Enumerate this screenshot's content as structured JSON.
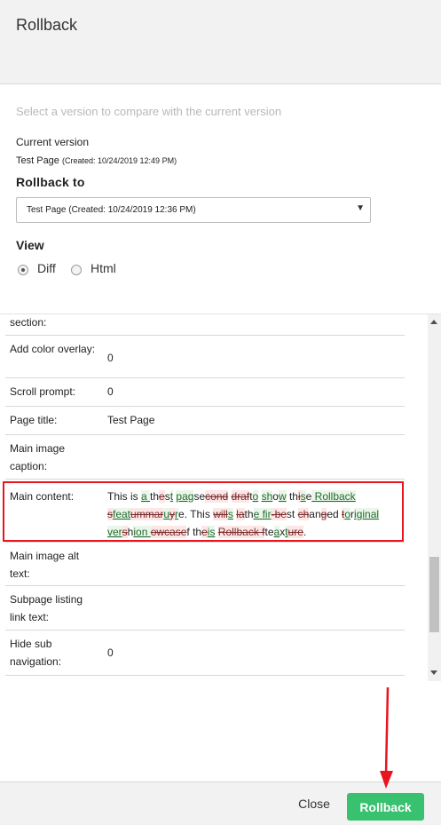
{
  "dialog": {
    "title": "Rollback"
  },
  "controls": {
    "hint": "Select a version to compare with the current version",
    "current_label": "Current version",
    "current_name": "Test Page",
    "current_created": "(Created: 10/24/2019 12:49 PM)",
    "rollback_label": "Rollback to",
    "selected_version": "Test Page (Created: 10/24/2019 12:36 PM)",
    "view_label": "View",
    "view_options": [
      "Diff",
      "Html"
    ],
    "view_selected": "Diff"
  },
  "rows": [
    {
      "label": "section:",
      "value": ""
    },
    {
      "label": "Add color overlay:",
      "value": "0"
    },
    {
      "label": "Scroll prompt:",
      "value": "0"
    },
    {
      "label": "Page title:",
      "value": "Test Page"
    },
    {
      "label": "Main image caption:",
      "value": ""
    },
    {
      "label": "Main content:",
      "value": ""
    },
    {
      "label": "Main image alt text:",
      "value": ""
    },
    {
      "label": "Subpage listing link text:",
      "value": ""
    },
    {
      "label": "Hide sub navigation:",
      "value": "0"
    }
  ],
  "diff_segments": [
    {
      "t": "n",
      "s": "This is "
    },
    {
      "t": "i",
      "s": "a "
    },
    {
      "t": "n",
      "s": "th"
    },
    {
      "t": "d",
      "s": "e"
    },
    {
      "t": "n",
      "s": "s"
    },
    {
      "t": "i",
      "s": "t"
    },
    {
      "t": "n",
      "s": " "
    },
    {
      "t": "i",
      "s": "pag"
    },
    {
      "t": "n",
      "s": "s"
    },
    {
      "t": "n",
      "s": "e"
    },
    {
      "t": "d",
      "s": "cond"
    },
    {
      "t": "n",
      "s": " "
    },
    {
      "t": "d",
      "s": "draf"
    },
    {
      "t": "n",
      "s": "t"
    },
    {
      "t": "i",
      "s": "o"
    },
    {
      "t": "n",
      "s": " "
    },
    {
      "t": "i",
      "s": "sh"
    },
    {
      "t": "n",
      "s": "o"
    },
    {
      "t": "i",
      "s": "w"
    },
    {
      "t": "n",
      "s": " th"
    },
    {
      "t": "d",
      "s": "i"
    },
    {
      "t": "i",
      "s": "s"
    },
    {
      "t": "n",
      "s": "e"
    },
    {
      "t": "i",
      "s": " Rollback"
    },
    {
      "t": "n",
      "s": " "
    },
    {
      "t": "d",
      "s": "s"
    },
    {
      "t": "i",
      "s": "feat"
    },
    {
      "t": "d",
      "s": "ummar"
    },
    {
      "t": "i",
      "s": "u"
    },
    {
      "t": "d",
      "s": "y"
    },
    {
      "t": "i",
      "s": "r"
    },
    {
      "t": "n",
      "s": "e. This "
    },
    {
      "t": "d",
      "s": "will"
    },
    {
      "t": "i",
      "s": "s"
    },
    {
      "t": "n",
      "s": " "
    },
    {
      "t": "d",
      "s": "la"
    },
    {
      "t": "n",
      "s": "th"
    },
    {
      "t": "i",
      "s": "e fir"
    },
    {
      "t": "d",
      "s": "-be"
    },
    {
      "t": "n",
      "s": "st "
    },
    {
      "t": "d",
      "s": "ch"
    },
    {
      "t": "n",
      "s": "an"
    },
    {
      "t": "d",
      "s": "g"
    },
    {
      "t": "n",
      "s": "ed "
    },
    {
      "t": "d",
      "s": "t"
    },
    {
      "t": "i",
      "s": "o"
    },
    {
      "t": "n",
      "s": "r"
    },
    {
      "t": "i",
      "s": "iginal"
    },
    {
      "t": "n",
      "s": " "
    },
    {
      "t": "i",
      "s": "ver"
    },
    {
      "t": "d",
      "s": "s"
    },
    {
      "t": "n",
      "s": "h"
    },
    {
      "t": "i",
      "s": "ion "
    },
    {
      "t": "d",
      "s": "owcase"
    },
    {
      "t": "n",
      "s": "f th"
    },
    {
      "t": "d",
      "s": "e"
    },
    {
      "t": "i",
      "s": "is"
    },
    {
      "t": "n",
      "s": " "
    },
    {
      "t": "d",
      "s": "Rollback f"
    },
    {
      "t": "n",
      "s": "te"
    },
    {
      "t": "i",
      "s": "a"
    },
    {
      "t": "n",
      "s": "x"
    },
    {
      "t": "i",
      "s": "t"
    },
    {
      "t": "d",
      "s": "ure"
    },
    {
      "t": "n",
      "s": "."
    }
  ],
  "footer": {
    "close_label": "Close",
    "rollback_label": "Rollback"
  },
  "colors": {
    "rollback_button": "#38c16f",
    "highlight_box": "#e8141e",
    "annotation_arrow": "#e8141e"
  }
}
